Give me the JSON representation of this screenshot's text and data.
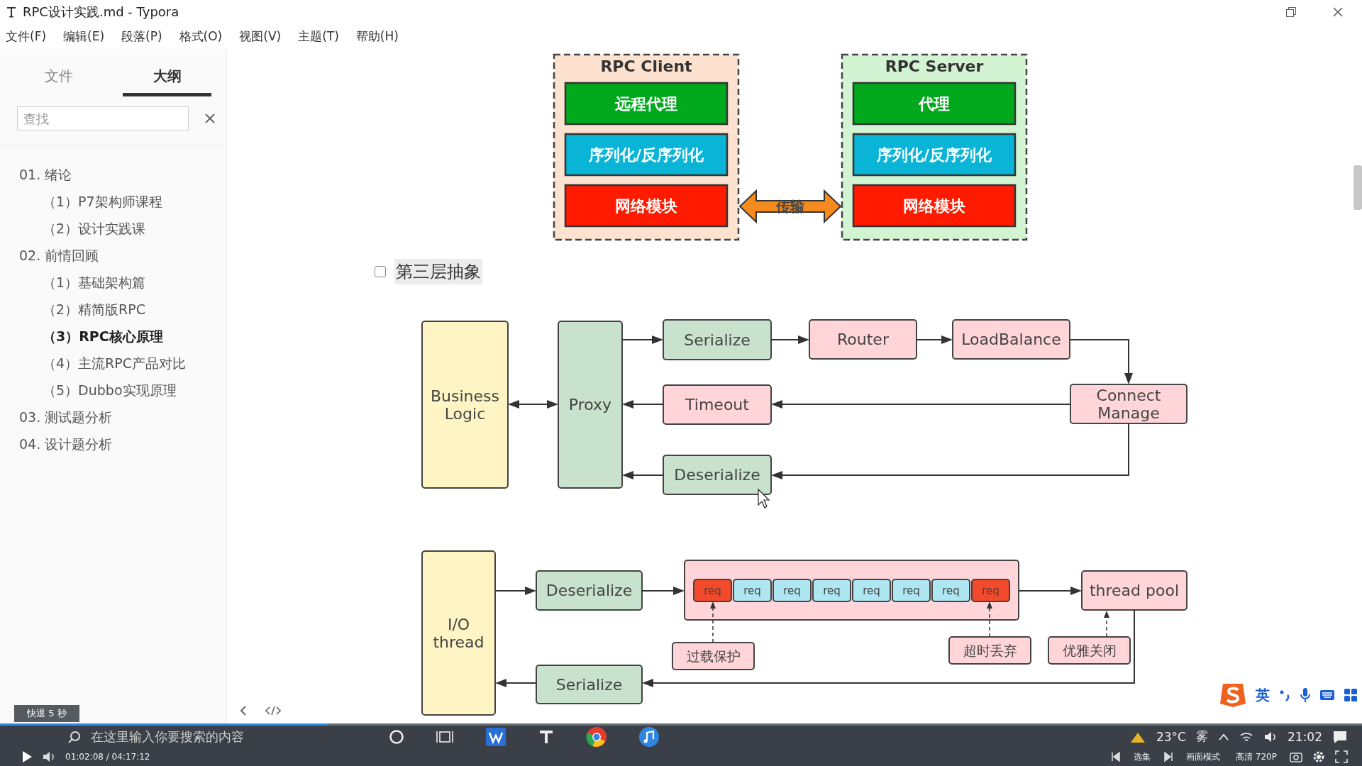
{
  "window": {
    "title": "RPC设计实践.md - Typora"
  },
  "menu": [
    "文件(F)",
    "编辑(E)",
    "段落(P)",
    "格式(O)",
    "视图(V)",
    "主题(T)",
    "帮助(H)"
  ],
  "sidebar": {
    "tabs": [
      {
        "label": "文件",
        "selected": false
      },
      {
        "label": "大纲",
        "selected": true
      }
    ],
    "search": {
      "placeholder": "查找"
    },
    "outline": [
      {
        "label": "01. 绪论",
        "selected": false,
        "children": [
          {
            "label": "（1）P7架构师课程",
            "selected": false
          },
          {
            "label": "（2）设计实践课",
            "selected": false
          }
        ]
      },
      {
        "label": "02. 前情回顾",
        "selected": false,
        "children": [
          {
            "label": "（1）基础架构篇",
            "selected": false
          },
          {
            "label": "（2）精简版RPC",
            "selected": false
          },
          {
            "label": "（3）RPC核心原理",
            "selected": true
          },
          {
            "label": "（4）主流RPC产品对比",
            "selected": false
          },
          {
            "label": "（5）Dubbo实现原理",
            "selected": false
          }
        ]
      },
      {
        "label": "03. 测试题分析",
        "selected": false
      },
      {
        "label": "04. 设计题分析",
        "selected": false
      }
    ]
  },
  "layers_diagram": {
    "client": {
      "title": "RPC Client",
      "color": "#fde2cf",
      "layers": [
        {
          "label": "远程代理",
          "color": "#00a81c"
        },
        {
          "label": "序列化/反序列化",
          "color": "#0ab4d6"
        },
        {
          "label": "网络模块",
          "color": "#ff1a00"
        }
      ]
    },
    "server": {
      "title": "RPC Server",
      "color": "#d3f4d3",
      "layers": [
        {
          "label": "代理",
          "color": "#00a81c"
        },
        {
          "label": "序列化/反序列化",
          "color": "#0ab4d6"
        },
        {
          "label": "网络模块",
          "color": "#ff1a00"
        }
      ]
    },
    "link_label": "传输"
  },
  "task": {
    "label": "第三层抽象",
    "checked": false
  },
  "client_flow": {
    "nodes": [
      {
        "label": "Business Logic",
        "color": "#fff4c4"
      },
      {
        "label": "Proxy",
        "color": "#c8e2cd"
      },
      {
        "label": "Serialize",
        "color": "#c8e2cd"
      },
      {
        "label": "Router",
        "color": "#ffd5da"
      },
      {
        "label": "LoadBalance",
        "color": "#ffd5da"
      },
      {
        "label": "Timeout",
        "color": "#ffd5da"
      },
      {
        "label": "Connect Manage",
        "color": "#ffd5da"
      },
      {
        "label": "Deserialize",
        "color": "#c8e2cd"
      }
    ]
  },
  "server_flow": {
    "nodes": [
      {
        "label": "I/O thread",
        "color": "#fff4c4"
      },
      {
        "label": "Deserialize",
        "color": "#c8e2cd"
      },
      {
        "label": "thread pool",
        "color": "#ffd5da"
      },
      {
        "label": "Serialize",
        "color": "#c8e2cd"
      }
    ],
    "queue": {
      "color": "#ffd5da",
      "cells": [
        {
          "label": "req",
          "color": "#f24a2a"
        },
        {
          "label": "req",
          "color": "#aee6f2"
        },
        {
          "label": "req",
          "color": "#aee6f2"
        },
        {
          "label": "req",
          "color": "#aee6f2"
        },
        {
          "label": "req",
          "color": "#aee6f2"
        },
        {
          "label": "req",
          "color": "#aee6f2"
        },
        {
          "label": "req",
          "color": "#aee6f2"
        },
        {
          "label": "req",
          "color": "#f24a2a"
        }
      ]
    },
    "notes": [
      "过载保护",
      "超时丢弃",
      "优雅关闭"
    ]
  },
  "player": {
    "hint": "快退 5 秒",
    "time": "01:02:08 / 04:17:12",
    "progress": {
      "level": 0.24
    },
    "buttons": [
      "选集",
      "画面模式",
      "高清 720P"
    ]
  },
  "taskbar": {
    "search": {
      "placeholder": "在这里输入你要搜索的内容"
    },
    "temperature": "23°C",
    "weather": "雾",
    "clock": "21:02"
  },
  "ime": {
    "mode": "英"
  }
}
